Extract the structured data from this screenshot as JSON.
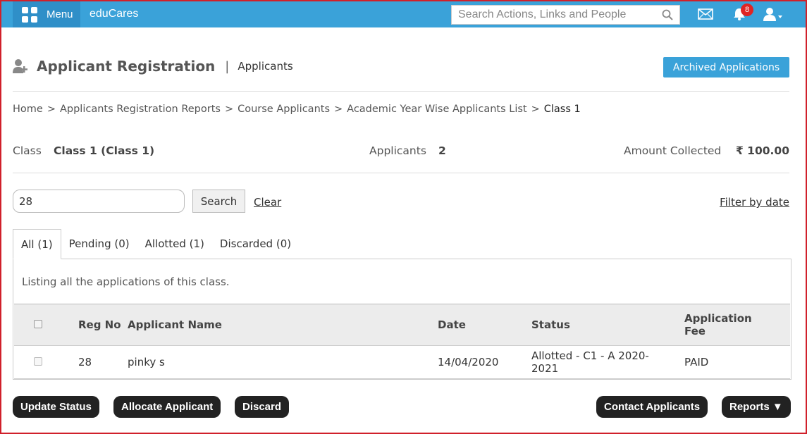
{
  "topbar": {
    "menu_label": "Menu",
    "brand": "eduCares",
    "search_placeholder": "Search Actions, Links and People",
    "notification_count": "8"
  },
  "header": {
    "title": "Applicant Registration",
    "separator": "|",
    "subtitle": "Applicants",
    "archived_button": "Archived Applications"
  },
  "breadcrumb": [
    "Home",
    "Applicants Registration Reports",
    "Course Applicants",
    "Academic Year Wise Applicants List",
    "Class 1"
  ],
  "breadcrumb_sep": ">",
  "summary": {
    "class_label": "Class",
    "class_value": "Class 1 (Class 1)",
    "applicants_label": "Applicants",
    "applicants_value": "2",
    "amount_label": "Amount Collected",
    "amount_value": "₹ 100.00"
  },
  "filter": {
    "input_value": "28",
    "search_button": "Search",
    "clear_link": "Clear",
    "date_link": "Filter by date"
  },
  "tabs": [
    {
      "label": "All (1)",
      "active": true
    },
    {
      "label": "Pending (0)",
      "active": false
    },
    {
      "label": "Allotted (1)",
      "active": false
    },
    {
      "label": "Discarded (0)",
      "active": false
    }
  ],
  "listing_text": "Listing all the applications of this class.",
  "table": {
    "columns": [
      "Reg No",
      "Applicant Name",
      "Date",
      "Status",
      "Application Fee"
    ],
    "rows": [
      {
        "reg_no": "28",
        "name": "pinky s",
        "date": "14/04/2020",
        "status": "Allotted - C1 - A 2020-2021",
        "fee": "PAID"
      }
    ]
  },
  "actions": {
    "update_status": "Update Status",
    "allocate": "Allocate Applicant",
    "discard": "Discard",
    "contact": "Contact Applicants",
    "reports": "Reports ▼"
  },
  "colors": {
    "topbar": "#3aa2d9",
    "frame_border": "#d0202a",
    "badge": "#e02424",
    "dark_button": "#222222"
  },
  "icons": [
    "grid-icon",
    "search-icon",
    "mail-icon",
    "bell-icon",
    "user-icon",
    "user-add-icon"
  ]
}
